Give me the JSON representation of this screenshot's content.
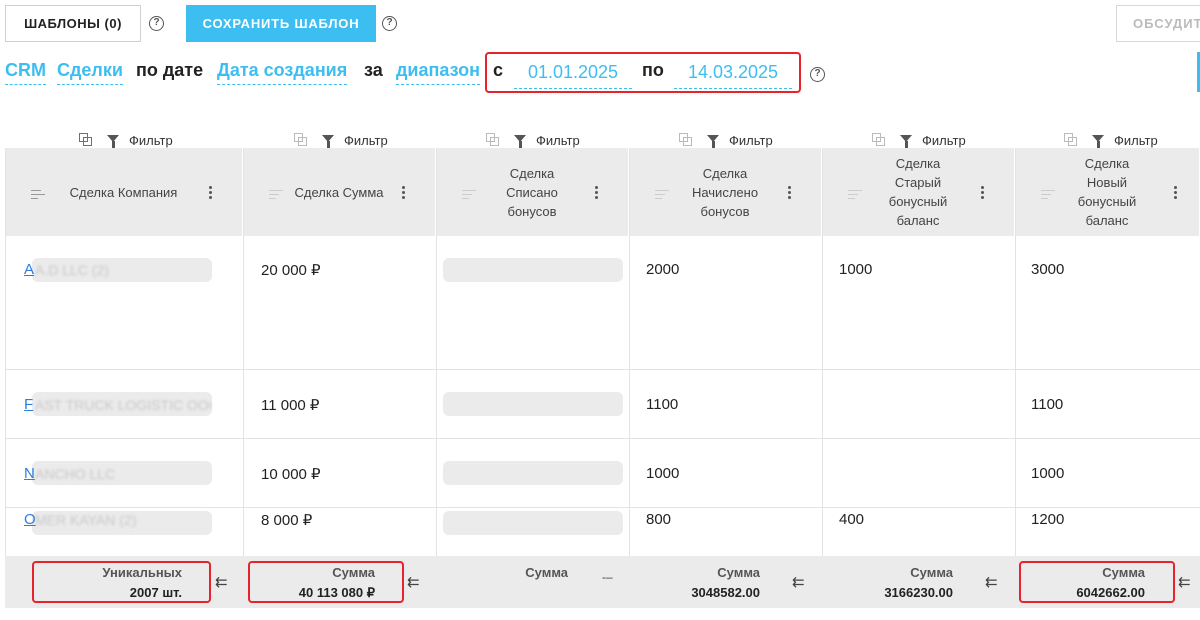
{
  "toolbar": {
    "templates_label": "ШАБЛОНЫ (0)",
    "save_template_label": "СОХРАНИТЬ ШАБЛОН",
    "discuss_label": "ОБСУДИТ"
  },
  "filter_line": {
    "source": "CRM",
    "entity": "Сделки",
    "by_date": "по дате",
    "date_field": "Дата создания",
    "for": "за",
    "range": "диапазон",
    "from_label": "с",
    "from_value": "01.01.2025",
    "to_label": "по",
    "to_value": "14.03.2025"
  },
  "table": {
    "filter_label": "Фильтр",
    "columns": [
      {
        "title": "Сделка Компания"
      },
      {
        "title": "Сделка Сумма"
      },
      {
        "title": "Сделка Списано бонусов"
      },
      {
        "title": "Сделка Начислено бонусов"
      },
      {
        "title": "Сделка Старый бонусный баланс"
      },
      {
        "title": "Сделка Новый бонусный баланс"
      }
    ],
    "rows": [
      {
        "company_initial": "A",
        "company_rest": "A.D LLC (2)",
        "amount": "20 000 ₽",
        "accrued": "2000",
        "old_balance": "1000",
        "new_balance": "3000"
      },
      {
        "company_initial": "F",
        "company_rest": "AST TRUCK LOGISTIC OOO",
        "amount": "11 000 ₽",
        "accrued": "1100",
        "old_balance": "",
        "new_balance": "1100"
      },
      {
        "company_initial": "N",
        "company_rest": "ANCHO LLC",
        "amount": "10 000 ₽",
        "accrued": "1000",
        "old_balance": "",
        "new_balance": "1000"
      },
      {
        "company_initial": "O",
        "company_rest": "MER KAYAN (2)",
        "amount": "8 000 ₽",
        "accrued": "800",
        "old_balance": "400",
        "new_balance": "1200"
      }
    ],
    "footer": [
      {
        "label": "Уникальных",
        "value": "2007 шт."
      },
      {
        "label": "Сумма",
        "value": "40 113 080 ₽"
      },
      {
        "label": "Сумма",
        "value": ""
      },
      {
        "label": "Сумма",
        "value": "3048582.00"
      },
      {
        "label": "Сумма",
        "value": "3166230.00"
      },
      {
        "label": "Сумма",
        "value": "6042662.00"
      }
    ]
  },
  "colors": {
    "accent": "#3dbef0",
    "highlight": "#e8232b",
    "link": "#2a7de1"
  }
}
